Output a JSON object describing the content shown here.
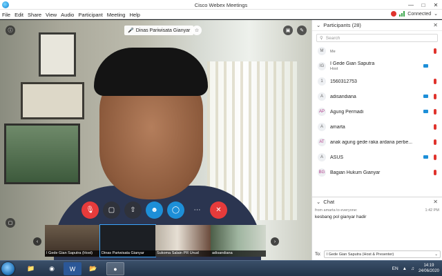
{
  "window": {
    "title": "Cisco Webex Meetings"
  },
  "menu": {
    "items": [
      "File",
      "Edit",
      "Share",
      "View",
      "Audio",
      "Participant",
      "Meeting",
      "Help"
    ]
  },
  "status": {
    "connection": "Connected"
  },
  "video": {
    "active_speaker": "Dinas Pariwisata Gianyar"
  },
  "thumbnails": [
    {
      "label": "I Gede Gian Saputra (Host)"
    },
    {
      "label": "Dinas Pariwisata Gianyar"
    },
    {
      "label": "Sukoma Salain PR Unud"
    },
    {
      "label": "adisandiana"
    }
  ],
  "participants": {
    "header": "Participants (28)",
    "search_placeholder": "Search",
    "items": [
      {
        "initial": "M",
        "name": "",
        "sub": "Me",
        "color": "#666"
      },
      {
        "initial": "IG",
        "name": "I Gede Gian Saputra",
        "sub": "Host",
        "color": "#666"
      },
      {
        "initial": "1",
        "name": "1560312753",
        "sub": "",
        "color": "#666"
      },
      {
        "initial": "A",
        "name": "adisandiana",
        "sub": "",
        "color": "#666"
      },
      {
        "initial": "AP",
        "name": "Agung Permadi",
        "sub": "",
        "color": "#b13c8b"
      },
      {
        "initial": "A",
        "name": "amarta",
        "sub": "",
        "color": "#666"
      },
      {
        "initial": "AT",
        "name": "anak agung gede raka ardana perbe...",
        "sub": "",
        "color": "#b13c8b"
      },
      {
        "initial": "A",
        "name": "ASUS",
        "sub": "",
        "color": "#666"
      },
      {
        "initial": "BG",
        "name": "Bagian Hukum Gianyar",
        "sub": "",
        "color": "#b13c8b"
      }
    ]
  },
  "chat": {
    "header": "Chat",
    "from": "from amarta to everyone:",
    "time": "1:42 PM",
    "message": "kesbang pol gianyar hadir",
    "to_label": "To:",
    "to_value": "I Gede Gian Saputra (Host & Presenter)"
  },
  "taskbar": {
    "lang": "EN",
    "time": "14:19",
    "date": "24/06/2020"
  },
  "colors": {
    "accent": "#1d8fd8",
    "danger": "#e63b3b",
    "record": "#e0332d"
  }
}
